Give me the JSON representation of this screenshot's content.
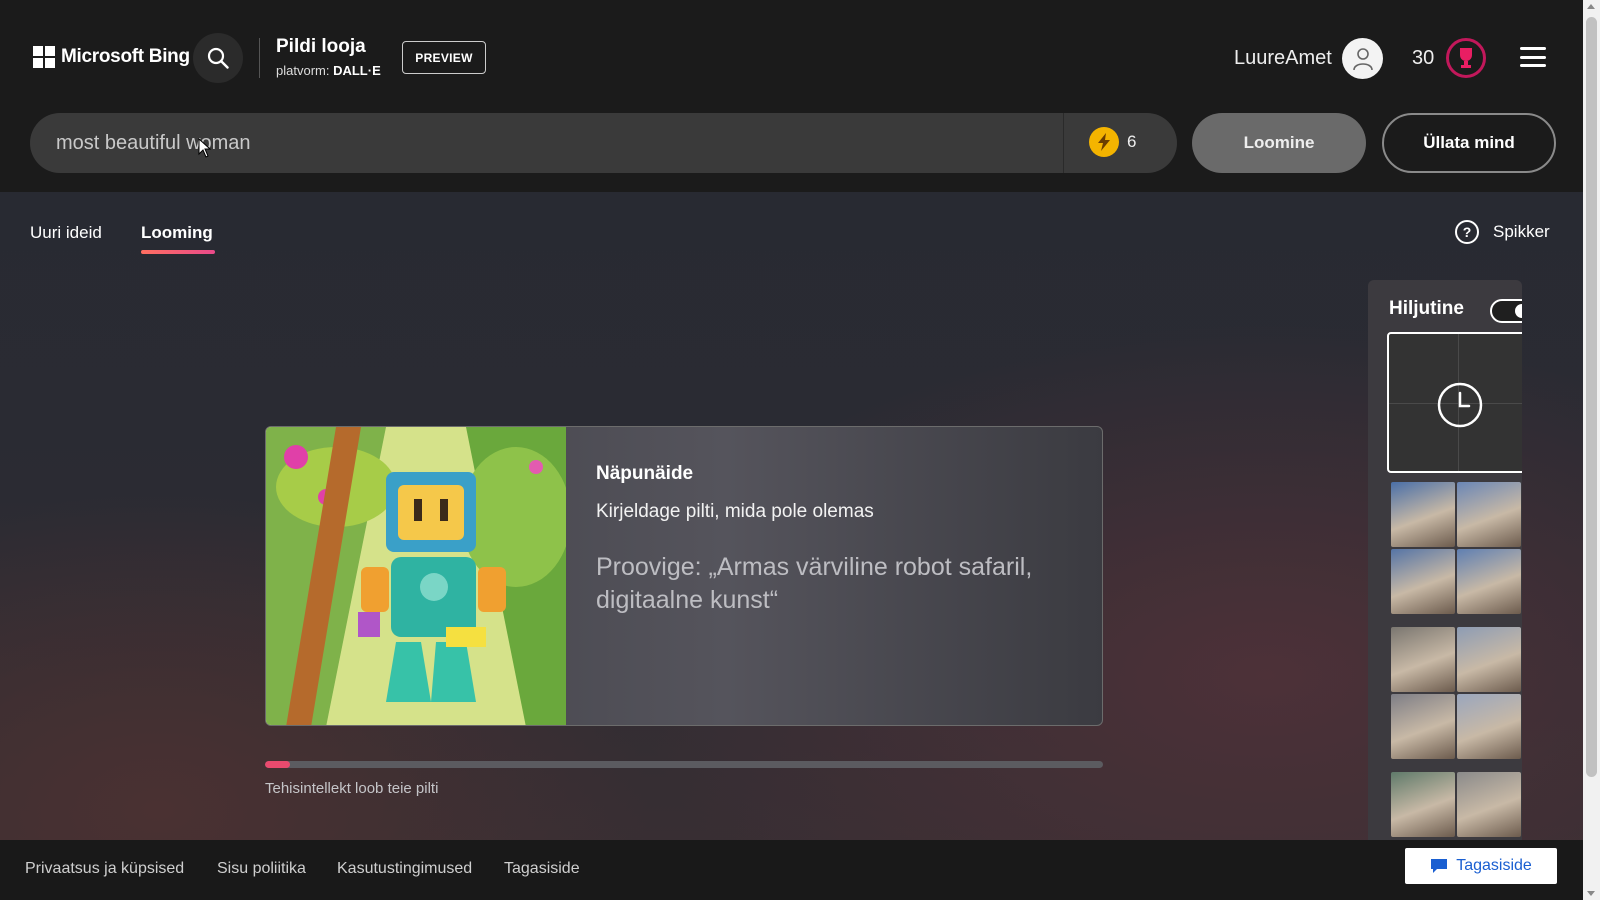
{
  "header": {
    "brand": "Microsoft Bing",
    "product_title": "Pildi looja",
    "product_sub_prefix": "platvorm:",
    "product_sub_model": "DALL·E",
    "preview_label": "PREVIEW",
    "user_name": "LuureAmet",
    "rewards_points": "30",
    "accent_color": "#c2185b"
  },
  "prompt": {
    "value": "most beautiful woman",
    "boost_count": "6",
    "create_label": "Loomine",
    "surprise_label": "Üllata mind"
  },
  "tabs": [
    {
      "label": "Uuri ideid",
      "active": false
    },
    {
      "label": "Looming",
      "active": true
    }
  ],
  "help_label": "Spikker",
  "tip": {
    "title": "Näpunäide",
    "text": "Kirjeldage pilti, mida pole olemas",
    "example": "Proovige: „Armas värviline robot safaril, digitaalne kunst“"
  },
  "progress": {
    "fraction": 0.03,
    "label": "Tehisintellekt loob teie pilti"
  },
  "recent": {
    "title": "Hiljutine",
    "toggle_on": true,
    "thumb_groups": [
      [
        "#4a6fa8",
        "#6a86b6",
        "#5574a6",
        "#5f7fb2"
      ],
      [
        "#7a7670",
        "#8d9cb4",
        "#7e7e86",
        "#9aa6bd"
      ],
      [
        "#5f7a6a",
        "#8a8a8a"
      ]
    ]
  },
  "footer": {
    "links": [
      "Privaatsus ja küpsised",
      "Sisu poliitika",
      "Kasutustingimused",
      "Tagasiside"
    ],
    "feedback_button": "Tagasiside"
  },
  "icons": {
    "search": "search-icon",
    "avatar": "user-avatar-icon",
    "trophy": "trophy-icon",
    "menu": "hamburger-menu-icon",
    "boost": "lightning-icon",
    "help": "question-circle-icon",
    "pending": "clock-icon",
    "feedback": "chat-icon"
  }
}
